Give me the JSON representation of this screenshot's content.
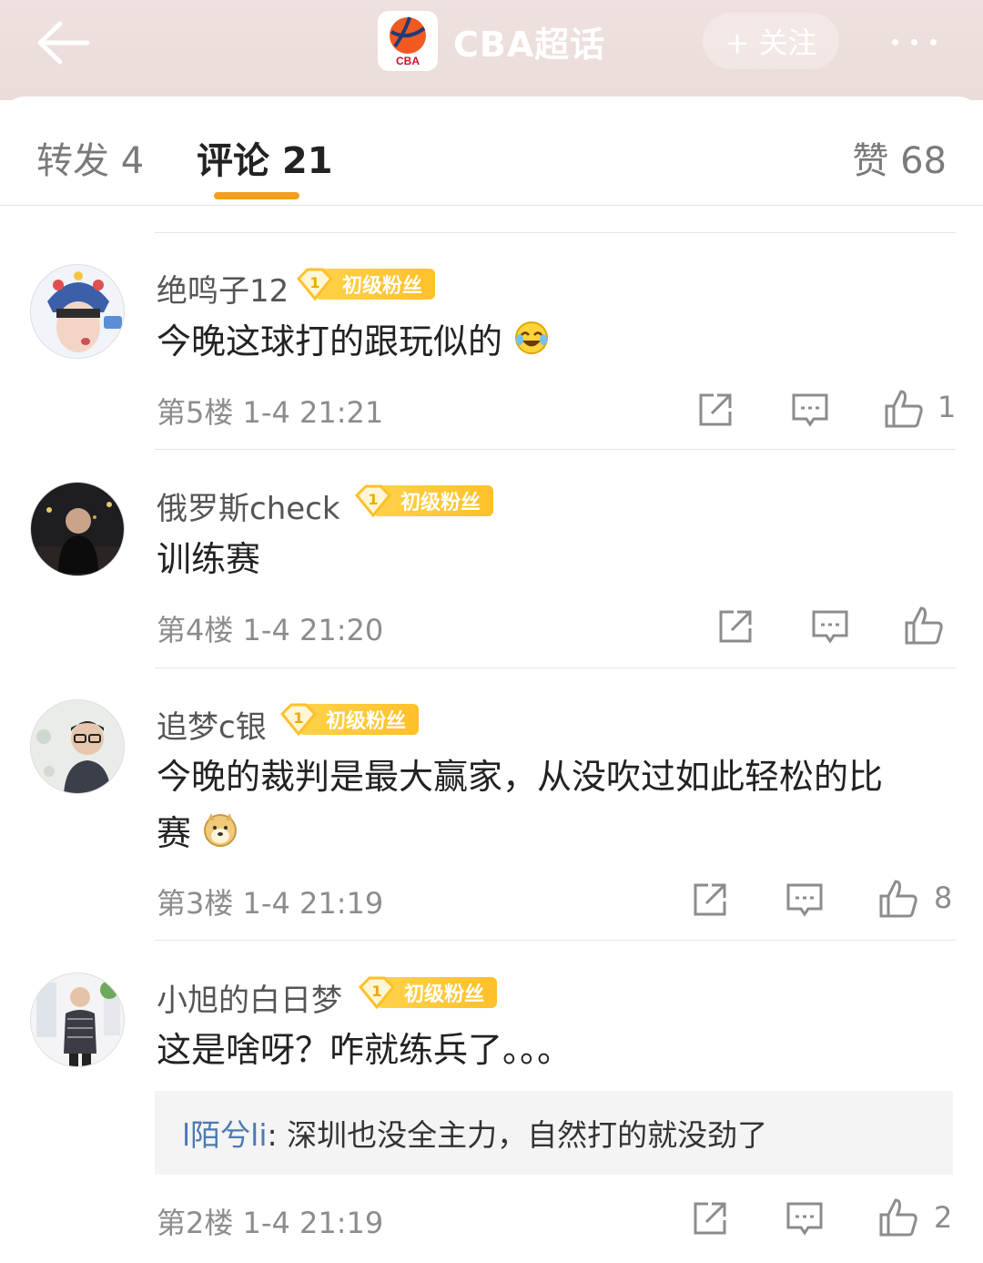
{
  "header": {
    "title": "CBA超话",
    "logo_text": "CBA",
    "follow_label": "+ 关注"
  },
  "tabs": {
    "repost": "转发 4",
    "comment": "评论 21",
    "like": "赞 68"
  },
  "badge_label": "初级粉丝",
  "badge_level": "1",
  "comments": [
    {
      "username": "绝鸣子12",
      "text": "今晚这球打的跟玩似的",
      "emoji": "laugh-cry",
      "meta": "第5楼 1-4 21:21",
      "likes": "1"
    },
    {
      "username": "俄罗斯check",
      "text": "训练赛",
      "meta": "第4楼 1-4 21:20",
      "likes": ""
    },
    {
      "username": "追梦c银",
      "text_line1": "今晚的裁判是最大赢家，从没吹过如此轻松的比",
      "text_line2": "赛",
      "emoji": "doge",
      "meta": "第3楼 1-4 21:19",
      "likes": "8"
    },
    {
      "username": "小旭的白日梦",
      "text": "这是啥呀？咋就练兵了。。。",
      "reply_user": "l陌兮li",
      "reply_text": ": 深圳也没全主力，自然打的就没劲了",
      "meta": "第2楼 1-4 21:19",
      "likes": "2"
    }
  ],
  "colors": {
    "header_bg": "#efe1df",
    "accent_orange": "#f59d1d",
    "badge_yellow": "#ffc02a",
    "reply_link": "#4d7ab3"
  }
}
